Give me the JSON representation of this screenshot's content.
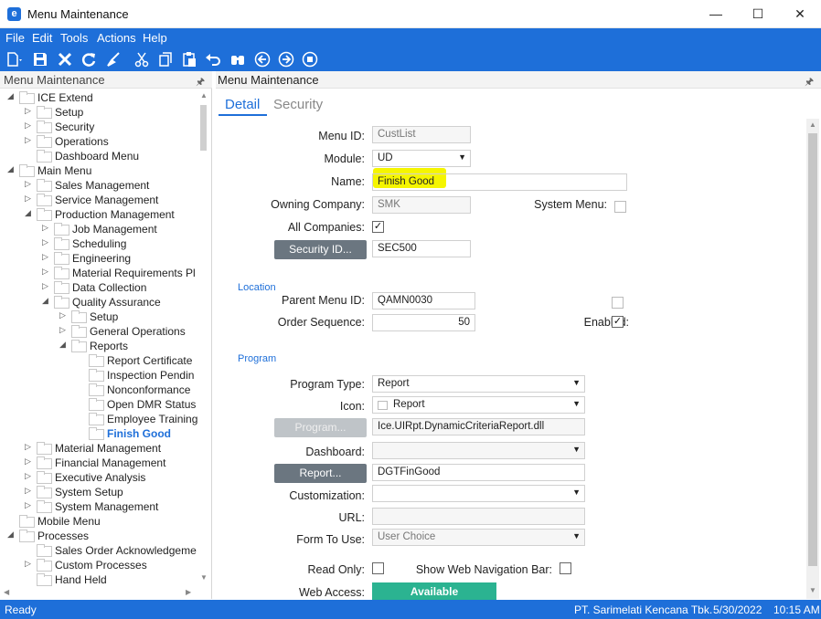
{
  "window": {
    "title": "Menu Maintenance",
    "logo_letter": "e",
    "minimize": "—",
    "maximize": "☐",
    "close": "✕"
  },
  "menu": [
    "File",
    "Edit",
    "Tools",
    "Actions",
    "Help"
  ],
  "toolbar_icons": [
    "new-icon",
    "save-icon",
    "delete-icon",
    "refresh-icon",
    "clear-icon",
    "cut-icon",
    "copy-icon",
    "paste-icon",
    "undo-icon",
    "search-icon",
    "back-icon",
    "forward-icon",
    "home-icon"
  ],
  "tree": {
    "title": "Menu Maintenance",
    "pin": "🖈",
    "items": [
      {
        "label": "ICE Extend",
        "level": 0,
        "arrow": "◢"
      },
      {
        "label": "Setup",
        "level": 1,
        "arrow": "▷"
      },
      {
        "label": "Security",
        "level": 1,
        "arrow": "▷"
      },
      {
        "label": "Operations",
        "level": 1,
        "arrow": "▷"
      },
      {
        "label": "Dashboard Menu",
        "level": 1,
        "arrow": ""
      },
      {
        "label": "Main Menu",
        "level": 0,
        "arrow": "◢"
      },
      {
        "label": "Sales Management",
        "level": 1,
        "arrow": "▷"
      },
      {
        "label": "Service Management",
        "level": 1,
        "arrow": "▷"
      },
      {
        "label": "Production Management",
        "level": 1,
        "arrow": "◢"
      },
      {
        "label": "Job Management",
        "level": 2,
        "arrow": "▷"
      },
      {
        "label": "Scheduling",
        "level": 2,
        "arrow": "▷"
      },
      {
        "label": "Engineering",
        "level": 2,
        "arrow": "▷"
      },
      {
        "label": "Material Requirements Pl",
        "level": 2,
        "arrow": "▷"
      },
      {
        "label": "Data Collection",
        "level": 2,
        "arrow": "▷"
      },
      {
        "label": "Quality Assurance",
        "level": 2,
        "arrow": "◢"
      },
      {
        "label": "Setup",
        "level": 3,
        "arrow": "▷"
      },
      {
        "label": "General Operations",
        "level": 3,
        "arrow": "▷"
      },
      {
        "label": "Reports",
        "level": 3,
        "arrow": "◢"
      },
      {
        "label": "Report Certificate",
        "level": 4,
        "arrow": ""
      },
      {
        "label": "Inspection Pendin",
        "level": 4,
        "arrow": ""
      },
      {
        "label": "Nonconformance",
        "level": 4,
        "arrow": ""
      },
      {
        "label": "Open DMR Status",
        "level": 4,
        "arrow": ""
      },
      {
        "label": "Employee Training",
        "level": 4,
        "arrow": ""
      },
      {
        "label": "Finish Good",
        "level": 4,
        "arrow": "",
        "selected": true
      },
      {
        "label": "Material Management",
        "level": 1,
        "arrow": "▷"
      },
      {
        "label": "Financial Management",
        "level": 1,
        "arrow": "▷"
      },
      {
        "label": "Executive Analysis",
        "level": 1,
        "arrow": "▷"
      },
      {
        "label": "System Setup",
        "level": 1,
        "arrow": "▷"
      },
      {
        "label": "System Management",
        "level": 1,
        "arrow": "▷"
      },
      {
        "label": "Mobile Menu",
        "level": 0,
        "arrow": ""
      },
      {
        "label": "Processes",
        "level": 0,
        "arrow": "◢"
      },
      {
        "label": "Sales Order Acknowledgeme",
        "level": 1,
        "arrow": ""
      },
      {
        "label": "Custom Processes",
        "level": 1,
        "arrow": "▷"
      },
      {
        "label": "Hand Held",
        "level": 1,
        "arrow": ""
      }
    ]
  },
  "main": {
    "title": "Menu Maintenance",
    "pin": "🖈",
    "tabs": [
      "Detail",
      "Security"
    ],
    "menu_id_label": "Menu ID:",
    "menu_id": "CustList",
    "module_label": "Module:",
    "module": "UD",
    "name_label": "Name:",
    "name": "Finish Good",
    "owning_company_label": "Owning Company:",
    "owning_company": "SMK",
    "system_menu_label": "System Menu:",
    "system_menu_checked": false,
    "all_companies_label": "All Companies:",
    "all_companies_checked": true,
    "security_id_button": "Security ID...",
    "security_id": "SEC500",
    "location_section": "Location",
    "parent_menu_id_label": "Parent Menu ID:",
    "parent_menu_id": "QAMN0030",
    "order_sequence_label": "Order Sequence:",
    "order_sequence": "50",
    "enabled_label": "Enabled:",
    "enabled_checked": true,
    "program_section": "Program",
    "program_type_label": "Program Type:",
    "program_type": "Report",
    "icon_label": "Icon:",
    "icon": "Report",
    "program_button": "Program...",
    "program": "Ice.UIRpt.DynamicCriteriaReport.dll",
    "dashboard_label": "Dashboard:",
    "dashboard": "",
    "report_button": "Report...",
    "report": "DGTFinGood",
    "customization_label": "Customization:",
    "customization": "",
    "url_label": "URL:",
    "url": "",
    "form_to_use_label": "Form To Use:",
    "form_to_use": "User Choice",
    "read_only_label": "Read Only:",
    "read_only_checked": false,
    "show_web_nav_label": "Show Web Navigation Bar:",
    "show_web_nav_checked": false,
    "web_access_label": "Web Access:",
    "web_access": "Available",
    "checkmark": "✓"
  },
  "status": {
    "left": "Ready",
    "company": "PT. Sarimelati Kencana Tbk.",
    "date": "5/30/2022",
    "time": "10:15 AM"
  },
  "colors": {
    "accent": "#1e6fd9",
    "web_access": "#2bb391",
    "highlight": "#f5f500"
  }
}
